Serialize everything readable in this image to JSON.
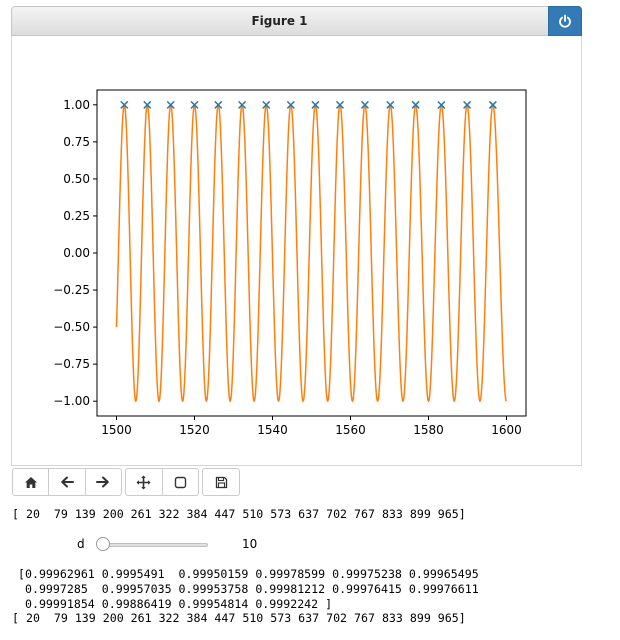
{
  "figure": {
    "title": "Figure 1",
    "power_icon": "power-icon"
  },
  "toolbar": {
    "buttons": [
      {
        "name": "home-button",
        "icon": "home-icon"
      },
      {
        "name": "back-button",
        "icon": "arrow-left-icon"
      },
      {
        "name": "forward-button",
        "icon": "arrow-right-icon"
      },
      {
        "name": "pan-button",
        "icon": "move-icon"
      },
      {
        "name": "zoom-button",
        "icon": "zoom-rect-icon"
      },
      {
        "name": "save-button",
        "icon": "floppy-icon"
      }
    ]
  },
  "output": {
    "peaks_line_1": "[ 20  79 139 200 261 322 384 447 510 573 637 702 767 833 899 965]",
    "values_line_1": "[0.99962961 0.9995491  0.99950159 0.99978599 0.99975238 0.99965495",
    "values_line_2": " 0.9997285  0.99957035 0.99953758 0.99981212 0.99976415 0.99976611",
    "values_line_3": " 0.99991854 0.99886419 0.99954814 0.9992242 ]",
    "peaks_line_2": "[ 20  79 139 200 261 322 384 447 510 573 637 702 767 833 899 965]"
  },
  "slider": {
    "label": "d",
    "value": "10",
    "level": 0.0
  },
  "chart_data": {
    "type": "line",
    "xlim": [
      1495,
      1605
    ],
    "ylim": [
      -1.1,
      1.1
    ],
    "x_ticks": [
      1500,
      1520,
      1540,
      1560,
      1580,
      1600
    ],
    "x_tick_labels": [
      "1500",
      "1520",
      "1540",
      "1560",
      "1580",
      "1600"
    ],
    "y_ticks": [
      1.0,
      0.75,
      0.5,
      0.25,
      0.0,
      -0.25,
      -0.5,
      -0.75,
      -1.0
    ],
    "y_tick_labels": [
      "1.00",
      "0.75",
      "0.50",
      "0.25",
      "0.00",
      "−0.25",
      "−0.50",
      "−0.75",
      "−1.00"
    ],
    "series": [
      {
        "kind": "line",
        "color": "#ff7f0e",
        "x_start": 1500,
        "x_end": 1600,
        "start_y": -0.5,
        "end_y": -1.0,
        "peak_x": [
          1502.0,
          1507.9,
          1513.9,
          1520.0,
          1526.1,
          1532.2,
          1538.4,
          1544.7,
          1551.0,
          1557.3,
          1563.7,
          1570.2,
          1576.7,
          1583.3,
          1589.9,
          1596.5
        ]
      },
      {
        "kind": "markers",
        "marker": "x",
        "color": "#1f77b4",
        "x": [
          1502.0,
          1507.9,
          1513.9,
          1520.0,
          1526.1,
          1532.2,
          1538.4,
          1544.7,
          1551.0,
          1557.3,
          1563.7,
          1570.2,
          1576.7,
          1583.3,
          1589.9,
          1596.5
        ],
        "y": [
          0.99962961,
          0.9995491,
          0.99950159,
          0.99978599,
          0.99975238,
          0.99965495,
          0.9997285,
          0.99957035,
          0.99953758,
          0.99981212,
          0.99976415,
          0.99976611,
          0.99991854,
          0.99886419,
          0.99954814,
          0.9992242
        ]
      }
    ]
  }
}
